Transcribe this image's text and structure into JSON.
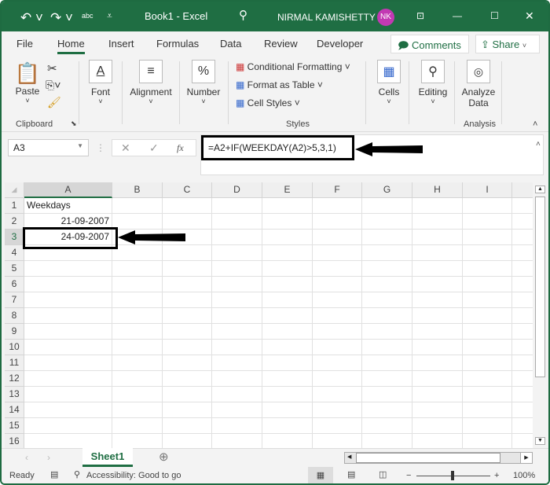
{
  "title_bar": {
    "doc_title": "Book1  -  Excel",
    "user_name": "NIRMAL KAMISHETTY",
    "avatar_initials": "NK",
    "qat_spell": "abc"
  },
  "tabs": [
    "File",
    "Home",
    "Insert",
    "Formulas",
    "Data",
    "Review",
    "Developer"
  ],
  "comments_label": "Comments",
  "share_label": "Share",
  "ribbon": {
    "paste": "Paste",
    "clipboard": "Clipboard",
    "font": "Font",
    "alignment": "Alignment",
    "number": "Number",
    "number_icon": "%",
    "conditional": "Conditional Formatting",
    "format_table": "Format as Table",
    "cell_styles": "Cell Styles",
    "styles": "Styles",
    "cells": "Cells",
    "editing": "Editing",
    "analyze": "Analyze Data",
    "analysis": "Analysis"
  },
  "formula_bar": {
    "name_box": "A3",
    "fx": "fx",
    "formula": "=A2+IF(WEEKDAY(A2)>5,3,1)"
  },
  "columns": [
    "A",
    "B",
    "C",
    "D",
    "E",
    "F",
    "G",
    "H",
    "I"
  ],
  "rows": [
    [
      "Weekdays",
      ""
    ],
    [
      "",
      "21-09-2007"
    ],
    [
      "",
      "24-09-2007"
    ],
    [],
    [],
    [],
    [],
    [],
    [],
    [],
    [],
    [],
    [],
    [],
    [],
    []
  ],
  "selected_cell": "A3",
  "sheet_tab": "Sheet1",
  "status": {
    "ready": "Ready",
    "accessibility": "Accessibility: Good to go",
    "zoom": "100%"
  },
  "colors": {
    "accent": "#1f6e43",
    "avatar": "#c239b3"
  }
}
